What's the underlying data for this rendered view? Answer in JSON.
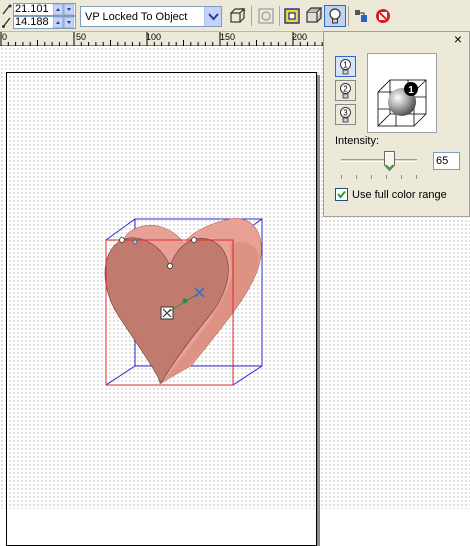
{
  "toolbar": {
    "x_value": "21.101",
    "y_value": "14.188",
    "vanishing_point": {
      "selected": "VP Locked To Object",
      "icon": "chevron-down-icon"
    },
    "icons": [
      "copy-vp-icon",
      "rotate-icon",
      "frontal-icon",
      "bevel-icon",
      "lighting-icon",
      "copy-extrude-icon",
      "clear-extrude-icon"
    ]
  },
  "ruler": {
    "labels": [
      "0",
      "50",
      "100",
      "150",
      "200"
    ]
  },
  "lighting_panel": {
    "close_label": "×",
    "lights": [
      {
        "label": "light-1"
      },
      {
        "label": "light-2"
      },
      {
        "label": "light-3"
      }
    ],
    "preview_light_number": "1",
    "intensity_label": "Intensity:",
    "intensity_value": "65",
    "intensity_level": 65,
    "full_color_range_label": "Use full color range",
    "full_color_range_checked": true
  },
  "colors": {
    "heart_front": "#c17a6e",
    "heart_side": "#e8a194",
    "bbox_red": "#e02a2a",
    "bbox_blue": "#2b2bc7",
    "accent_blue": "#316ac5"
  }
}
